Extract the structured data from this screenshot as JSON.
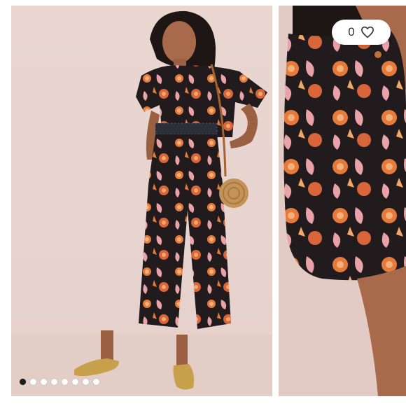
{
  "listing": {
    "like_count": "0",
    "like_icon": "heart-outline-icon",
    "carousel": {
      "total_slides": 8,
      "active_index": 0
    }
  },
  "colors": {
    "background": "#e9d6d1",
    "fabric": "#221b1d",
    "print_orange": "#e67a3a",
    "print_pink": "#e9a3a8",
    "active_dot": "#1c1c1c",
    "inactive_dot": "#ffffff"
  }
}
